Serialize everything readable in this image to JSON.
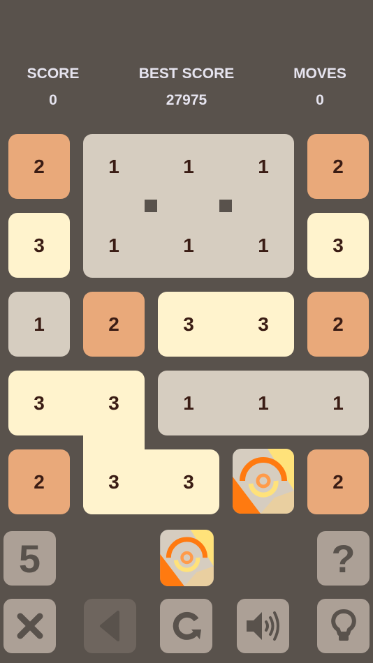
{
  "header": {
    "score": {
      "label": "SCORE",
      "value": "0"
    },
    "best_score": {
      "label": "BEST SCORE",
      "value": "27975"
    },
    "moves": {
      "label": "MOVES",
      "value": "0"
    }
  },
  "colors": {
    "background": "#59524c",
    "tile_1": "#d6cdc0",
    "tile_2": "#e9a97a",
    "tile_3": "#fff3cd",
    "text": "#3a1c14",
    "button": "#aca096",
    "button_disabled": "#6e655e"
  },
  "board": {
    "rows": [
      [
        "2",
        "1",
        "1",
        "1",
        "2"
      ],
      [
        "3",
        "1",
        "1",
        "1",
        "3"
      ],
      [
        "1",
        "2",
        "3",
        "3",
        "2"
      ],
      [
        "3",
        "3",
        "1",
        "1",
        "1"
      ],
      [
        "2",
        "3",
        "3",
        "special",
        "2"
      ]
    ]
  },
  "next_tile": "special-swirl",
  "controls": {
    "remaining": "5",
    "help": "?",
    "buttons": [
      "close",
      "undo",
      "restart",
      "sound",
      "hint"
    ]
  }
}
